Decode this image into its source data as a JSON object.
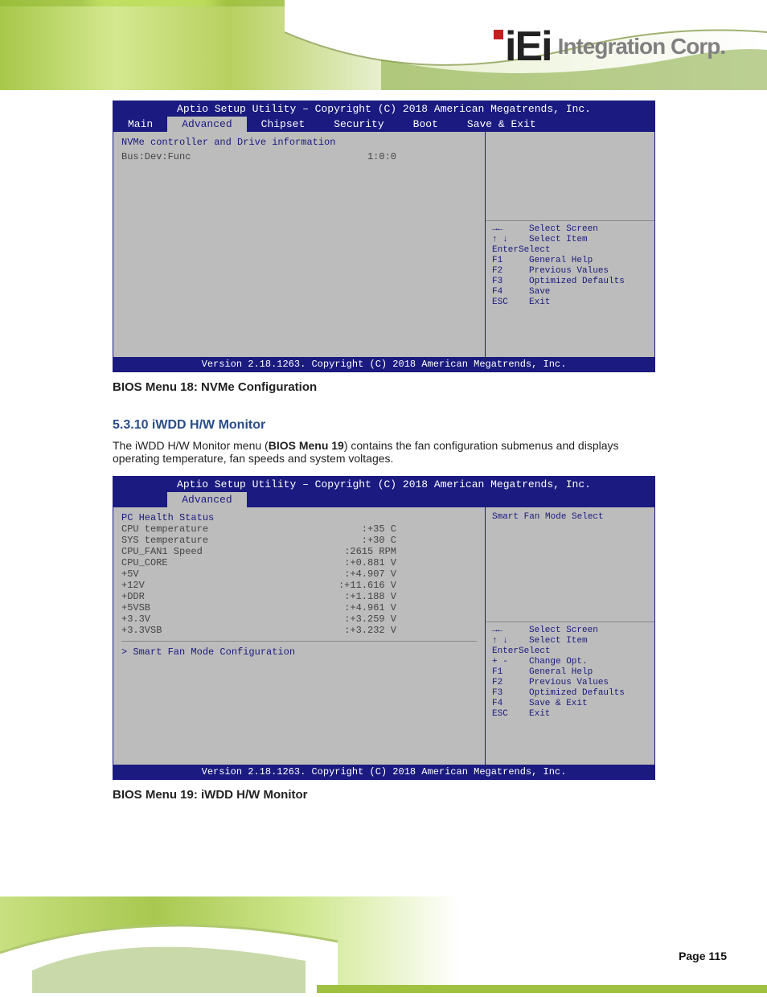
{
  "header": {
    "logo_iei": "iEi",
    "logo_rest": "Integration Corp."
  },
  "bios1": {
    "title": "Aptio Setup Utility – Copyright (C) 2018 American Megatrends, Inc.",
    "tabs": [
      "Main",
      "Advanced",
      "Chipset",
      "Security",
      "Boot",
      "Save & Exit"
    ],
    "active_tab": "Advanced",
    "left": {
      "sect": "NVMe controller and Drive information",
      "row_opt": "Bus:Dev:Func",
      "row_val": "1:0:0"
    },
    "help": {
      "arrows_lr": "Select Screen",
      "arrows_ud": "Select Item",
      "enter": "EnterSelect",
      "pm": "F1",
      "pm_t": "General Help",
      "f2": "F2",
      "f2_t": "Previous Values",
      "f3": "F3",
      "f3_t": "Optimized Defaults",
      "f4": "F4",
      "f4_t": "Save",
      "esc": "ESC",
      "esc_t": "Exit"
    },
    "version": "Version 2.18.1263. Copyright (C) 2018 American Megatrends, Inc.",
    "caption": "BIOS Menu 18: NVMe Configuration"
  },
  "section": {
    "heading": "5.3.10 iWDD H/W Monitor",
    "para_prefix": "The iWDD H/W Monitor menu (",
    "para_link": "BIOS Menu 19",
    "para_suffix": ") contains the fan configuration submenus and displays operating temperature, fan speeds and system voltages."
  },
  "bios2": {
    "title": "Aptio Setup Utility – Copyright (C) 2018 American Megatrends, Inc.",
    "tabs": [
      "",
      "Advanced",
      ""
    ],
    "active_tab": "Advanced",
    "left": {
      "sect": "PC Health Status",
      "rows": [
        {
          "opt": "CPU temperature",
          "val": ":+35 C"
        },
        {
          "opt": "SYS temperature",
          "val": ":+30 C"
        },
        {
          "opt": "CPU_FAN1 Speed",
          "val": ":2615 RPM"
        },
        {
          "opt": "CPU_CORE",
          "val": ":+0.881 V"
        },
        {
          "opt": "+5V",
          "val": ":+4.907 V"
        },
        {
          "opt": "+12V",
          "val": ":+11.616 V"
        },
        {
          "opt": "+DDR",
          "val": ":+1.188 V"
        },
        {
          "opt": "+5VSB",
          "val": ":+4.961 V"
        },
        {
          "opt": "+3.3V",
          "val": ":+3.259 V"
        },
        {
          "opt": "+3.3VSB",
          "val": ":+3.232 V"
        }
      ],
      "submenu": "> Smart Fan Mode Configuration"
    },
    "help": {
      "desc": "Smart Fan Mode Select",
      "arrows_lr": "Select Screen",
      "arrows_ud": "Select Item",
      "enter": "EnterSelect",
      "pm": "+ -",
      "pm_t": "Change Opt.",
      "f1": "F1",
      "f1_t": "General Help",
      "f2": "F2",
      "f2_t": "Previous Values",
      "f3": "F3",
      "f3_t": "Optimized Defaults",
      "f4": "F4",
      "f4_t": "Save & Exit",
      "esc": "ESC",
      "esc_t": "Exit"
    },
    "version": "Version 2.18.1263. Copyright (C) 2018 American Megatrends, Inc.",
    "caption": "BIOS Menu 19: iWDD H/W Monitor"
  },
  "page_num": "Page 115"
}
